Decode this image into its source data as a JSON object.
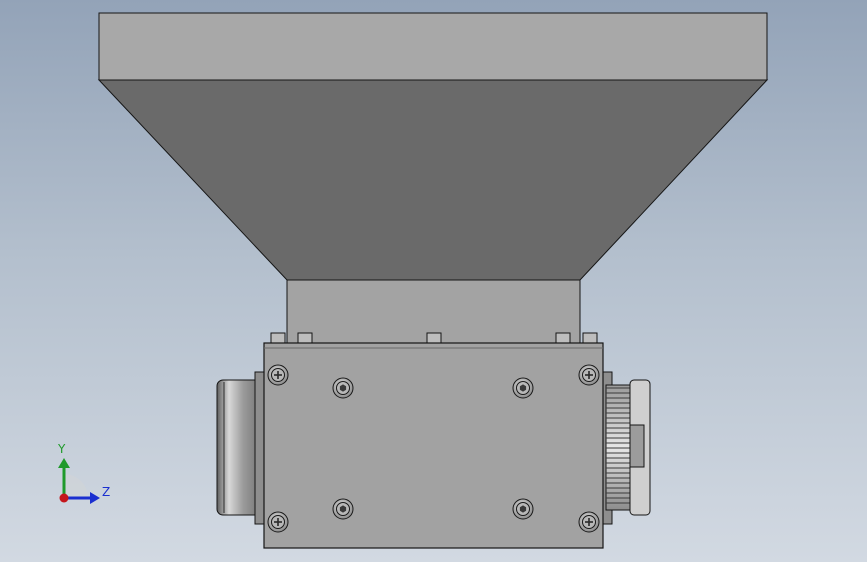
{
  "viewport": {
    "background_top": "#93a3b8",
    "background_bottom": "#d2d9e2"
  },
  "triad": {
    "y_label": "Y",
    "z_label": "Z",
    "y_color": "#1f9a2b",
    "z_color": "#1a2fd0",
    "x_color": "#c4161c"
  },
  "model": {
    "hopper_rim_color": "#a8a8a8",
    "hopper_funnel_color": "#6a6a6a",
    "neck_color": "#a3a3a3",
    "body_color": "#a2a2a2",
    "edge_color": "#151515"
  }
}
